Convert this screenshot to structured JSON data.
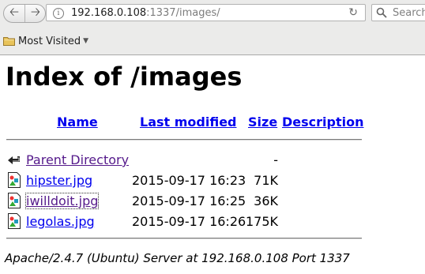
{
  "browser": {
    "url_host": "192.168.0.108",
    "url_rest": ":1337/images/",
    "search_placeholder": "Search",
    "bookmarks_label": "Most Visited"
  },
  "page": {
    "title": "Index of /images",
    "columns": {
      "name": "Name",
      "last_modified": "Last modified",
      "size": "Size",
      "description": "Description"
    },
    "parent": {
      "name": "Parent Directory",
      "size": "-"
    },
    "files": [
      {
        "name": "hipster.jpg",
        "modified": "2015-09-17 16:23",
        "size": "71K"
      },
      {
        "name": "iwilldoit.jpg",
        "modified": "2015-09-17 16:25",
        "size": "36K"
      },
      {
        "name": "legolas.jpg",
        "modified": "2015-09-17 16:26",
        "size": "175K"
      }
    ],
    "footer": "Apache/2.4.7 (Ubuntu) Server at 192.168.0.108 Port 1337"
  },
  "colors": {
    "link": "#0000ee",
    "visited_link": "#551a8b",
    "chrome_bg": "#ebebea"
  }
}
